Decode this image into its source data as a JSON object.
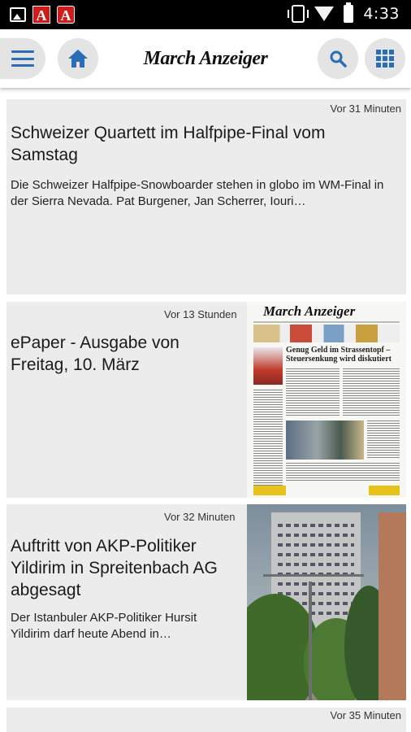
{
  "status_bar": {
    "time": "4:33",
    "icons": [
      "image-icon",
      "acrobat-icon",
      "acrobat-alt-icon",
      "vibrate-icon",
      "wifi-off-icon",
      "battery-icon"
    ]
  },
  "app_bar": {
    "logo_text": "March Anzeiger",
    "accent_color": "#2a6db8",
    "buttons": [
      "menu-icon",
      "home-icon",
      "search-icon",
      "apps-grid-icon"
    ]
  },
  "articles": [
    {
      "time": "Vor 31 Minuten",
      "title": "Schweizer Quartett im Halfpipe-Final vom Samstag",
      "teaser": "Die Schweizer Halfpipe-Snowboarder stehen in globo im WM-Final in der Sierra Nevada. Pat Burgener, Jan Scherrer, Iouri…"
    },
    {
      "time": "Vor 13 Stunden",
      "title": "ePaper - Ausgabe von Freitag, 10. März",
      "thumb": {
        "masthead": "March Anzeiger",
        "headline": "Genug Geld im Strassentopf – Steuersenkung wird diskutiert"
      }
    },
    {
      "time": "Vor 32 Minuten",
      "title": "Auftritt von AKP-Politiker Yildirim in Spreitenbach AG abgesagt",
      "teaser": "Der Istanbuler AKP-Politiker Hursit Yildirim darf heute Abend in…"
    },
    {
      "time": "Vor 35 Minuten"
    }
  ]
}
